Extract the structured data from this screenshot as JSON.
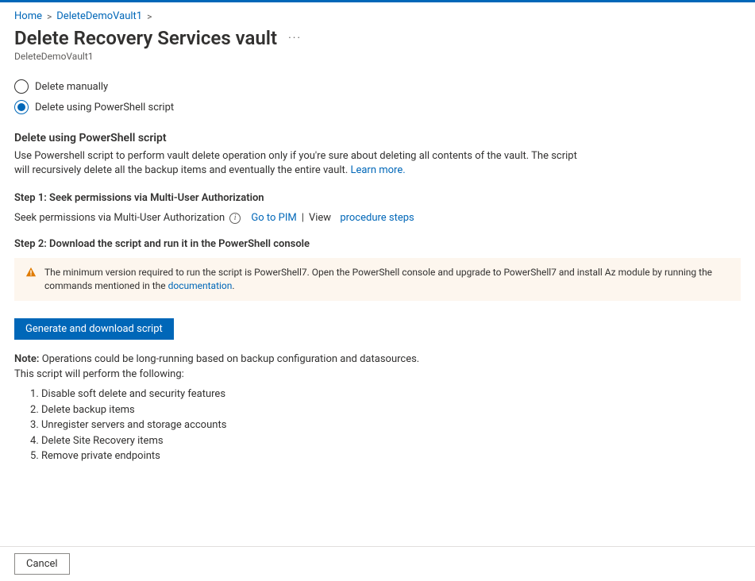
{
  "breadcrumb": {
    "home": "Home",
    "vault": "DeleteDemoVault1"
  },
  "title": "Delete Recovery Services vault",
  "subtitle": "DeleteDemoVault1",
  "radios": {
    "manual": "Delete manually",
    "script": "Delete using PowerShell script"
  },
  "section": {
    "heading": "Delete using PowerShell script",
    "desc": "Use Powershell script to perform vault delete operation only if you're sure about deleting all contents of the vault. The script will recursively delete all the backup items and eventually the entire vault. ",
    "learn_more": "Learn more."
  },
  "step1": {
    "heading": "Step 1: Seek permissions via Multi-User Authorization",
    "text": "Seek permissions via Multi-User Authorization",
    "go_pim": "Go to PIM",
    "view": "View",
    "procedure": "procedure steps"
  },
  "step2": {
    "heading": "Step 2: Download the script and run it in the PowerShell console"
  },
  "warning": {
    "text": "The minimum version required to run the script is PowerShell7. Open the PowerShell console and upgrade to PowerShell7 and install Az module by running the commands mentioned in the ",
    "link": "documentation",
    "tail": "."
  },
  "generate_btn": "Generate and download script",
  "note": {
    "label": "Note:",
    "text": " Operations could be long-running based on backup configuration and datasources.",
    "sub": "This script will perform the following:"
  },
  "actions": [
    "Disable soft delete and security features",
    "Delete backup items",
    "Unregister servers and storage accounts",
    "Delete Site Recovery items",
    "Remove private endpoints"
  ],
  "footer": {
    "cancel": "Cancel"
  }
}
